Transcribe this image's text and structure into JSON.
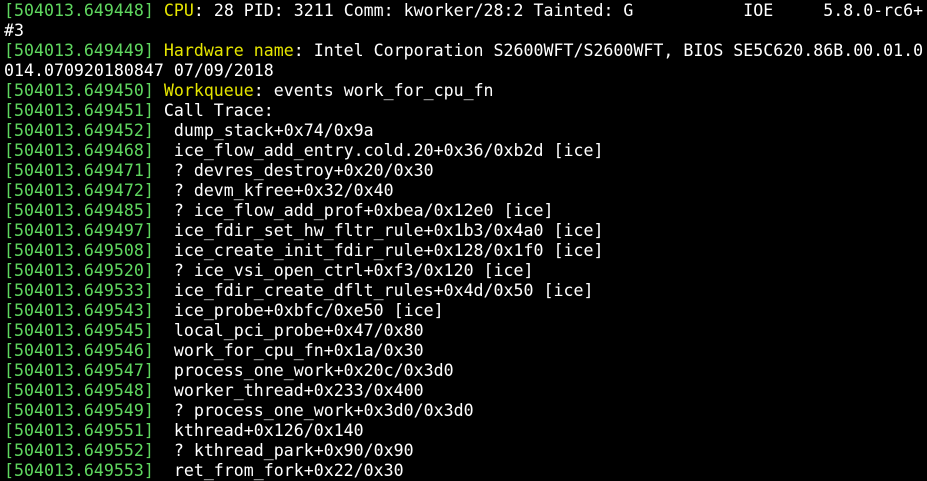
{
  "colors": {
    "background": "#000000",
    "timestamp": "#5fd75f",
    "keyword": "#e6e600",
    "text": "#ffffff"
  },
  "lines": [
    {
      "ts": "[504013.649448]",
      "key": "CPU",
      "text": ": 28 PID: 3211 Comm: kworker/28:2 Tainted: G           IOE     5.8.0-rc6+"
    },
    {
      "ts": "",
      "key": "",
      "text": "#3"
    },
    {
      "ts": "[504013.649449]",
      "key": "Hardware name",
      "text": ": Intel Corporation S2600WFT/S2600WFT, BIOS SE5C620.86B.00.01.0"
    },
    {
      "ts": "",
      "key": "",
      "text": "014.070920180847 07/09/2018"
    },
    {
      "ts": "[504013.649450]",
      "key": "Workqueue",
      "text": ": events work_for_cpu_fn"
    },
    {
      "ts": "[504013.649451]",
      "key": "",
      "text": "Call Trace:"
    },
    {
      "ts": "[504013.649452]",
      "key": "",
      "text": " dump_stack+0x74/0x9a"
    },
    {
      "ts": "[504013.649468]",
      "key": "",
      "text": " ice_flow_add_entry.cold.20+0x36/0xb2d [ice]"
    },
    {
      "ts": "[504013.649471]",
      "key": "",
      "text": " ? devres_destroy+0x20/0x30"
    },
    {
      "ts": "[504013.649472]",
      "key": "",
      "text": " ? devm_kfree+0x32/0x40"
    },
    {
      "ts": "[504013.649485]",
      "key": "",
      "text": " ? ice_flow_add_prof+0xbea/0x12e0 [ice]"
    },
    {
      "ts": "[504013.649497]",
      "key": "",
      "text": " ice_fdir_set_hw_fltr_rule+0x1b3/0x4a0 [ice]"
    },
    {
      "ts": "[504013.649508]",
      "key": "",
      "text": " ice_create_init_fdir_rule+0x128/0x1f0 [ice]"
    },
    {
      "ts": "[504013.649520]",
      "key": "",
      "text": " ? ice_vsi_open_ctrl+0xf3/0x120 [ice]"
    },
    {
      "ts": "[504013.649533]",
      "key": "",
      "text": " ice_fdir_create_dflt_rules+0x4d/0x50 [ice]"
    },
    {
      "ts": "[504013.649543]",
      "key": "",
      "text": " ice_probe+0xbfc/0xe50 [ice]"
    },
    {
      "ts": "[504013.649545]",
      "key": "",
      "text": " local_pci_probe+0x47/0x80"
    },
    {
      "ts": "[504013.649546]",
      "key": "",
      "text": " work_for_cpu_fn+0x1a/0x30"
    },
    {
      "ts": "[504013.649547]",
      "key": "",
      "text": " process_one_work+0x20c/0x3d0"
    },
    {
      "ts": "[504013.649548]",
      "key": "",
      "text": " worker_thread+0x233/0x400"
    },
    {
      "ts": "[504013.649549]",
      "key": "",
      "text": " ? process_one_work+0x3d0/0x3d0"
    },
    {
      "ts": "[504013.649551]",
      "key": "",
      "text": " kthread+0x126/0x140"
    },
    {
      "ts": "[504013.649552]",
      "key": "",
      "text": " ? kthread_park+0x90/0x90"
    },
    {
      "ts": "[504013.649553]",
      "key": "",
      "text": " ret_from_fork+0x22/0x30"
    }
  ]
}
